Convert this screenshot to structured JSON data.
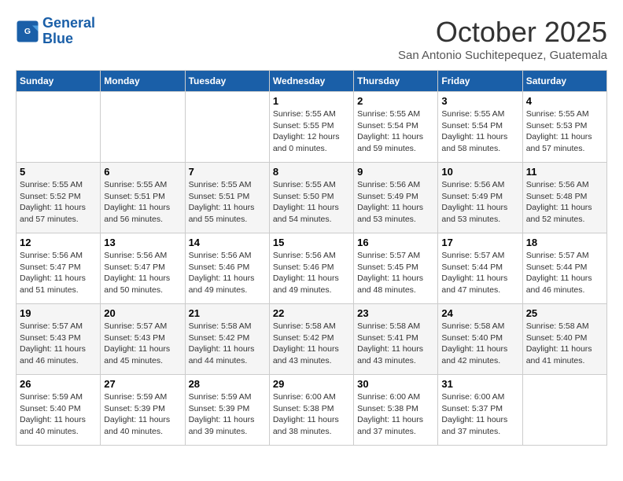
{
  "header": {
    "logo_line1": "General",
    "logo_line2": "Blue",
    "month": "October 2025",
    "location": "San Antonio Suchitepequez, Guatemala"
  },
  "days_of_week": [
    "Sunday",
    "Monday",
    "Tuesday",
    "Wednesday",
    "Thursday",
    "Friday",
    "Saturday"
  ],
  "weeks": [
    [
      {
        "day": "",
        "sunrise": "",
        "sunset": "",
        "daylight": ""
      },
      {
        "day": "",
        "sunrise": "",
        "sunset": "",
        "daylight": ""
      },
      {
        "day": "",
        "sunrise": "",
        "sunset": "",
        "daylight": ""
      },
      {
        "day": "1",
        "sunrise": "Sunrise: 5:55 AM",
        "sunset": "Sunset: 5:55 PM",
        "daylight": "Daylight: 12 hours and 0 minutes."
      },
      {
        "day": "2",
        "sunrise": "Sunrise: 5:55 AM",
        "sunset": "Sunset: 5:54 PM",
        "daylight": "Daylight: 11 hours and 59 minutes."
      },
      {
        "day": "3",
        "sunrise": "Sunrise: 5:55 AM",
        "sunset": "Sunset: 5:54 PM",
        "daylight": "Daylight: 11 hours and 58 minutes."
      },
      {
        "day": "4",
        "sunrise": "Sunrise: 5:55 AM",
        "sunset": "Sunset: 5:53 PM",
        "daylight": "Daylight: 11 hours and 57 minutes."
      }
    ],
    [
      {
        "day": "5",
        "sunrise": "Sunrise: 5:55 AM",
        "sunset": "Sunset: 5:52 PM",
        "daylight": "Daylight: 11 hours and 57 minutes."
      },
      {
        "day": "6",
        "sunrise": "Sunrise: 5:55 AM",
        "sunset": "Sunset: 5:51 PM",
        "daylight": "Daylight: 11 hours and 56 minutes."
      },
      {
        "day": "7",
        "sunrise": "Sunrise: 5:55 AM",
        "sunset": "Sunset: 5:51 PM",
        "daylight": "Daylight: 11 hours and 55 minutes."
      },
      {
        "day": "8",
        "sunrise": "Sunrise: 5:55 AM",
        "sunset": "Sunset: 5:50 PM",
        "daylight": "Daylight: 11 hours and 54 minutes."
      },
      {
        "day": "9",
        "sunrise": "Sunrise: 5:56 AM",
        "sunset": "Sunset: 5:49 PM",
        "daylight": "Daylight: 11 hours and 53 minutes."
      },
      {
        "day": "10",
        "sunrise": "Sunrise: 5:56 AM",
        "sunset": "Sunset: 5:49 PM",
        "daylight": "Daylight: 11 hours and 53 minutes."
      },
      {
        "day": "11",
        "sunrise": "Sunrise: 5:56 AM",
        "sunset": "Sunset: 5:48 PM",
        "daylight": "Daylight: 11 hours and 52 minutes."
      }
    ],
    [
      {
        "day": "12",
        "sunrise": "Sunrise: 5:56 AM",
        "sunset": "Sunset: 5:47 PM",
        "daylight": "Daylight: 11 hours and 51 minutes."
      },
      {
        "day": "13",
        "sunrise": "Sunrise: 5:56 AM",
        "sunset": "Sunset: 5:47 PM",
        "daylight": "Daylight: 11 hours and 50 minutes."
      },
      {
        "day": "14",
        "sunrise": "Sunrise: 5:56 AM",
        "sunset": "Sunset: 5:46 PM",
        "daylight": "Daylight: 11 hours and 49 minutes."
      },
      {
        "day": "15",
        "sunrise": "Sunrise: 5:56 AM",
        "sunset": "Sunset: 5:46 PM",
        "daylight": "Daylight: 11 hours and 49 minutes."
      },
      {
        "day": "16",
        "sunrise": "Sunrise: 5:57 AM",
        "sunset": "Sunset: 5:45 PM",
        "daylight": "Daylight: 11 hours and 48 minutes."
      },
      {
        "day": "17",
        "sunrise": "Sunrise: 5:57 AM",
        "sunset": "Sunset: 5:44 PM",
        "daylight": "Daylight: 11 hours and 47 minutes."
      },
      {
        "day": "18",
        "sunrise": "Sunrise: 5:57 AM",
        "sunset": "Sunset: 5:44 PM",
        "daylight": "Daylight: 11 hours and 46 minutes."
      }
    ],
    [
      {
        "day": "19",
        "sunrise": "Sunrise: 5:57 AM",
        "sunset": "Sunset: 5:43 PM",
        "daylight": "Daylight: 11 hours and 46 minutes."
      },
      {
        "day": "20",
        "sunrise": "Sunrise: 5:57 AM",
        "sunset": "Sunset: 5:43 PM",
        "daylight": "Daylight: 11 hours and 45 minutes."
      },
      {
        "day": "21",
        "sunrise": "Sunrise: 5:58 AM",
        "sunset": "Sunset: 5:42 PM",
        "daylight": "Daylight: 11 hours and 44 minutes."
      },
      {
        "day": "22",
        "sunrise": "Sunrise: 5:58 AM",
        "sunset": "Sunset: 5:42 PM",
        "daylight": "Daylight: 11 hours and 43 minutes."
      },
      {
        "day": "23",
        "sunrise": "Sunrise: 5:58 AM",
        "sunset": "Sunset: 5:41 PM",
        "daylight": "Daylight: 11 hours and 43 minutes."
      },
      {
        "day": "24",
        "sunrise": "Sunrise: 5:58 AM",
        "sunset": "Sunset: 5:40 PM",
        "daylight": "Daylight: 11 hours and 42 minutes."
      },
      {
        "day": "25",
        "sunrise": "Sunrise: 5:58 AM",
        "sunset": "Sunset: 5:40 PM",
        "daylight": "Daylight: 11 hours and 41 minutes."
      }
    ],
    [
      {
        "day": "26",
        "sunrise": "Sunrise: 5:59 AM",
        "sunset": "Sunset: 5:40 PM",
        "daylight": "Daylight: 11 hours and 40 minutes."
      },
      {
        "day": "27",
        "sunrise": "Sunrise: 5:59 AM",
        "sunset": "Sunset: 5:39 PM",
        "daylight": "Daylight: 11 hours and 40 minutes."
      },
      {
        "day": "28",
        "sunrise": "Sunrise: 5:59 AM",
        "sunset": "Sunset: 5:39 PM",
        "daylight": "Daylight: 11 hours and 39 minutes."
      },
      {
        "day": "29",
        "sunrise": "Sunrise: 6:00 AM",
        "sunset": "Sunset: 5:38 PM",
        "daylight": "Daylight: 11 hours and 38 minutes."
      },
      {
        "day": "30",
        "sunrise": "Sunrise: 6:00 AM",
        "sunset": "Sunset: 5:38 PM",
        "daylight": "Daylight: 11 hours and 37 minutes."
      },
      {
        "day": "31",
        "sunrise": "Sunrise: 6:00 AM",
        "sunset": "Sunset: 5:37 PM",
        "daylight": "Daylight: 11 hours and 37 minutes."
      },
      {
        "day": "",
        "sunrise": "",
        "sunset": "",
        "daylight": ""
      }
    ]
  ]
}
